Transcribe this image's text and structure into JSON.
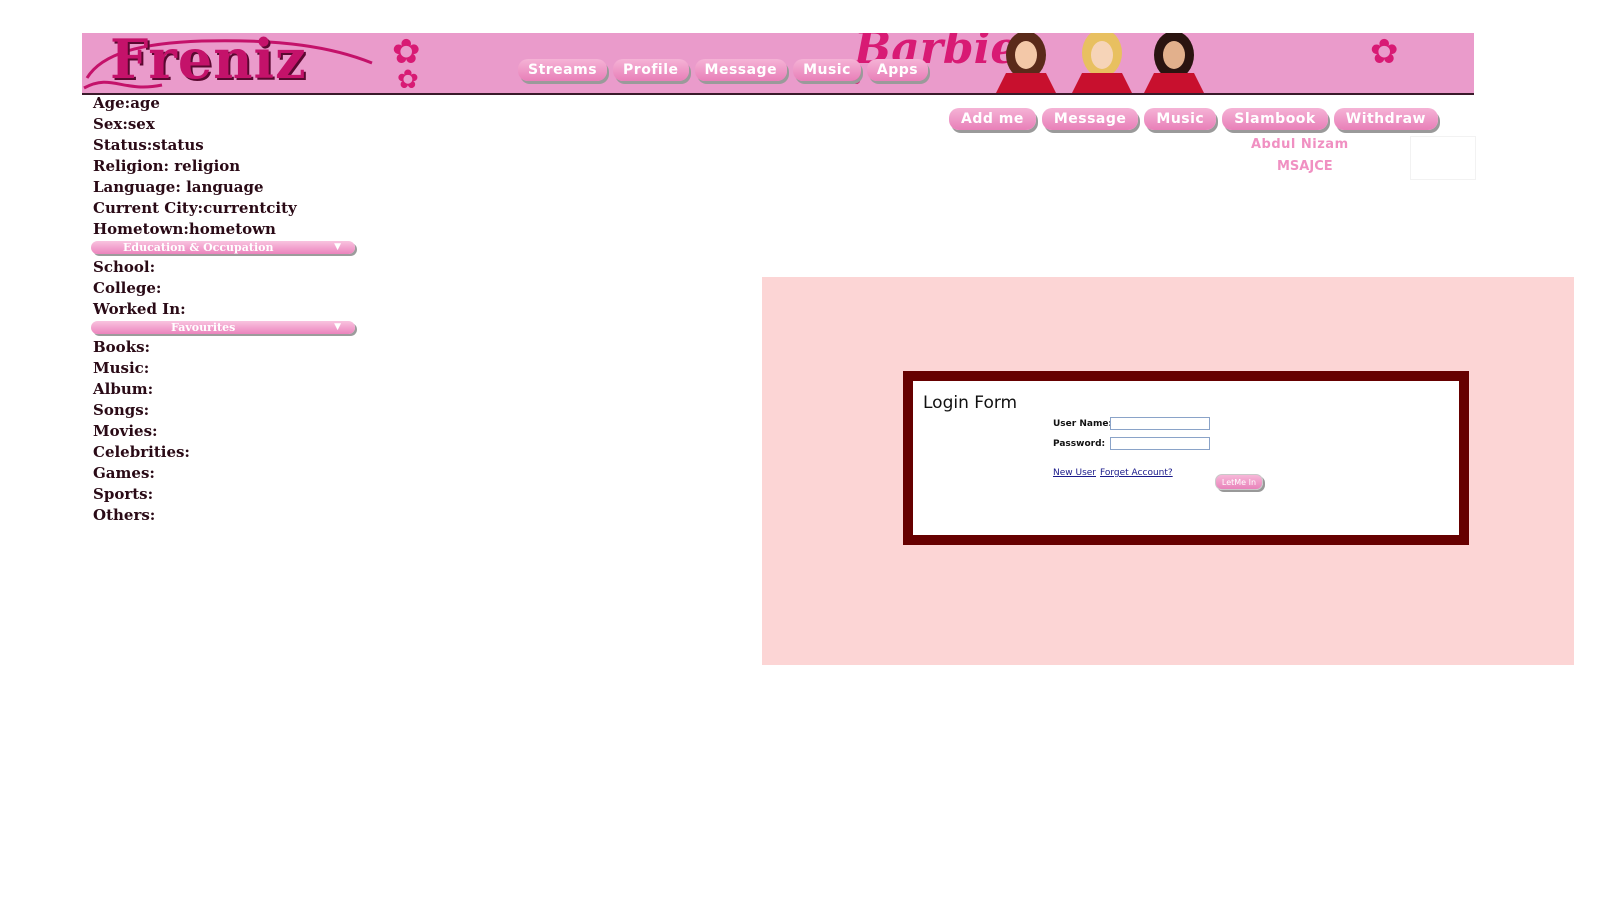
{
  "header": {
    "logo_text": "Freniz",
    "brand_text": "Barbie",
    "nav": [
      "Streams",
      "Profile",
      "Message",
      "Music",
      "Apps"
    ]
  },
  "profile": {
    "basic": [
      {
        "label": "Age:age"
      },
      {
        "label": "Sex:sex"
      },
      {
        "label": "Status:status"
      },
      {
        "label": "Religion: religion"
      },
      {
        "label": "Language: language"
      },
      {
        "label": "Current City:currentcity"
      },
      {
        "label": "Hometown:hometown"
      }
    ],
    "education_header": "Education & Occupation",
    "education": [
      "School:",
      "College:",
      "Worked In:"
    ],
    "favourites_header": "Favourites",
    "favourites": [
      "Books:",
      "Music:",
      "Album:",
      "Songs:",
      "Movies:",
      "Celebrities:",
      "Games:",
      "Sports:",
      "Others:"
    ]
  },
  "actions": [
    "Add me",
    "Message",
    "Music",
    "Slambook",
    "Withdraw"
  ],
  "user": {
    "name": "Abdul Nizam",
    "org": "MSAJCE"
  },
  "login": {
    "title": "Login Form",
    "username_label": "User Name:",
    "password_label": "Password:",
    "username_value": "",
    "password_value": "",
    "new_user": "New User",
    "forget": "Forget Account?",
    "submit": "LetMe In"
  },
  "colors": {
    "banner": "#ea9bcb",
    "accent_pink": "#d81a74",
    "panel_bg": "#fcd5d5",
    "frame": "#660000"
  }
}
